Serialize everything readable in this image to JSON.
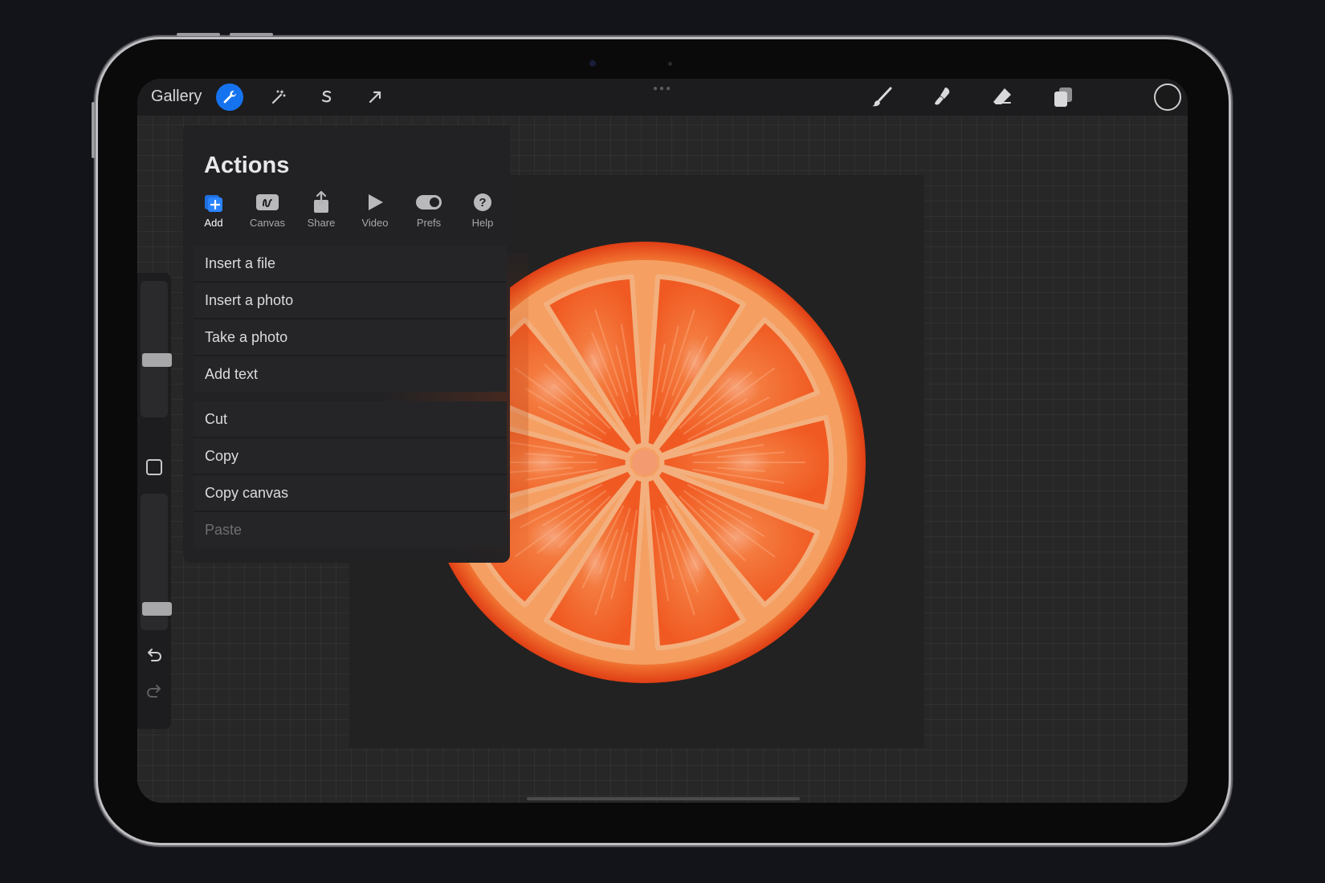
{
  "toolbar": {
    "gallery_label": "Gallery",
    "left_tools": [
      "wrench-icon",
      "magic-wand-icon",
      "selection-icon",
      "transform-arrow-icon"
    ],
    "right_tools": [
      "brush-icon",
      "smudge-icon",
      "eraser-icon",
      "layers-icon"
    ],
    "color_swatch": "#1a1a1a",
    "accent": "#1673f0"
  },
  "actions": {
    "title": "Actions",
    "tabs": [
      {
        "label": "Add",
        "icon": "add-icon",
        "active": true
      },
      {
        "label": "Canvas",
        "icon": "canvas-icon",
        "active": false
      },
      {
        "label": "Share",
        "icon": "share-icon",
        "active": false
      },
      {
        "label": "Video",
        "icon": "play-icon",
        "active": false
      },
      {
        "label": "Prefs",
        "icon": "toggle-icon",
        "active": false
      },
      {
        "label": "Help",
        "icon": "help-icon",
        "active": false
      }
    ],
    "group1": [
      "Insert a file",
      "Insert a photo",
      "Take a photo",
      "Add text"
    ],
    "group2": [
      "Cut",
      "Copy",
      "Copy canvas",
      "Paste"
    ]
  },
  "sidebar": {
    "size_slider_level": 0.41,
    "opacity_slider_level": 0.12
  },
  "artwork": {
    "subject": "orange-slice",
    "rind_color": "#e8401a",
    "pith_color": "#f6a05e",
    "segment_color": "#f0602a",
    "background": "#222222"
  }
}
